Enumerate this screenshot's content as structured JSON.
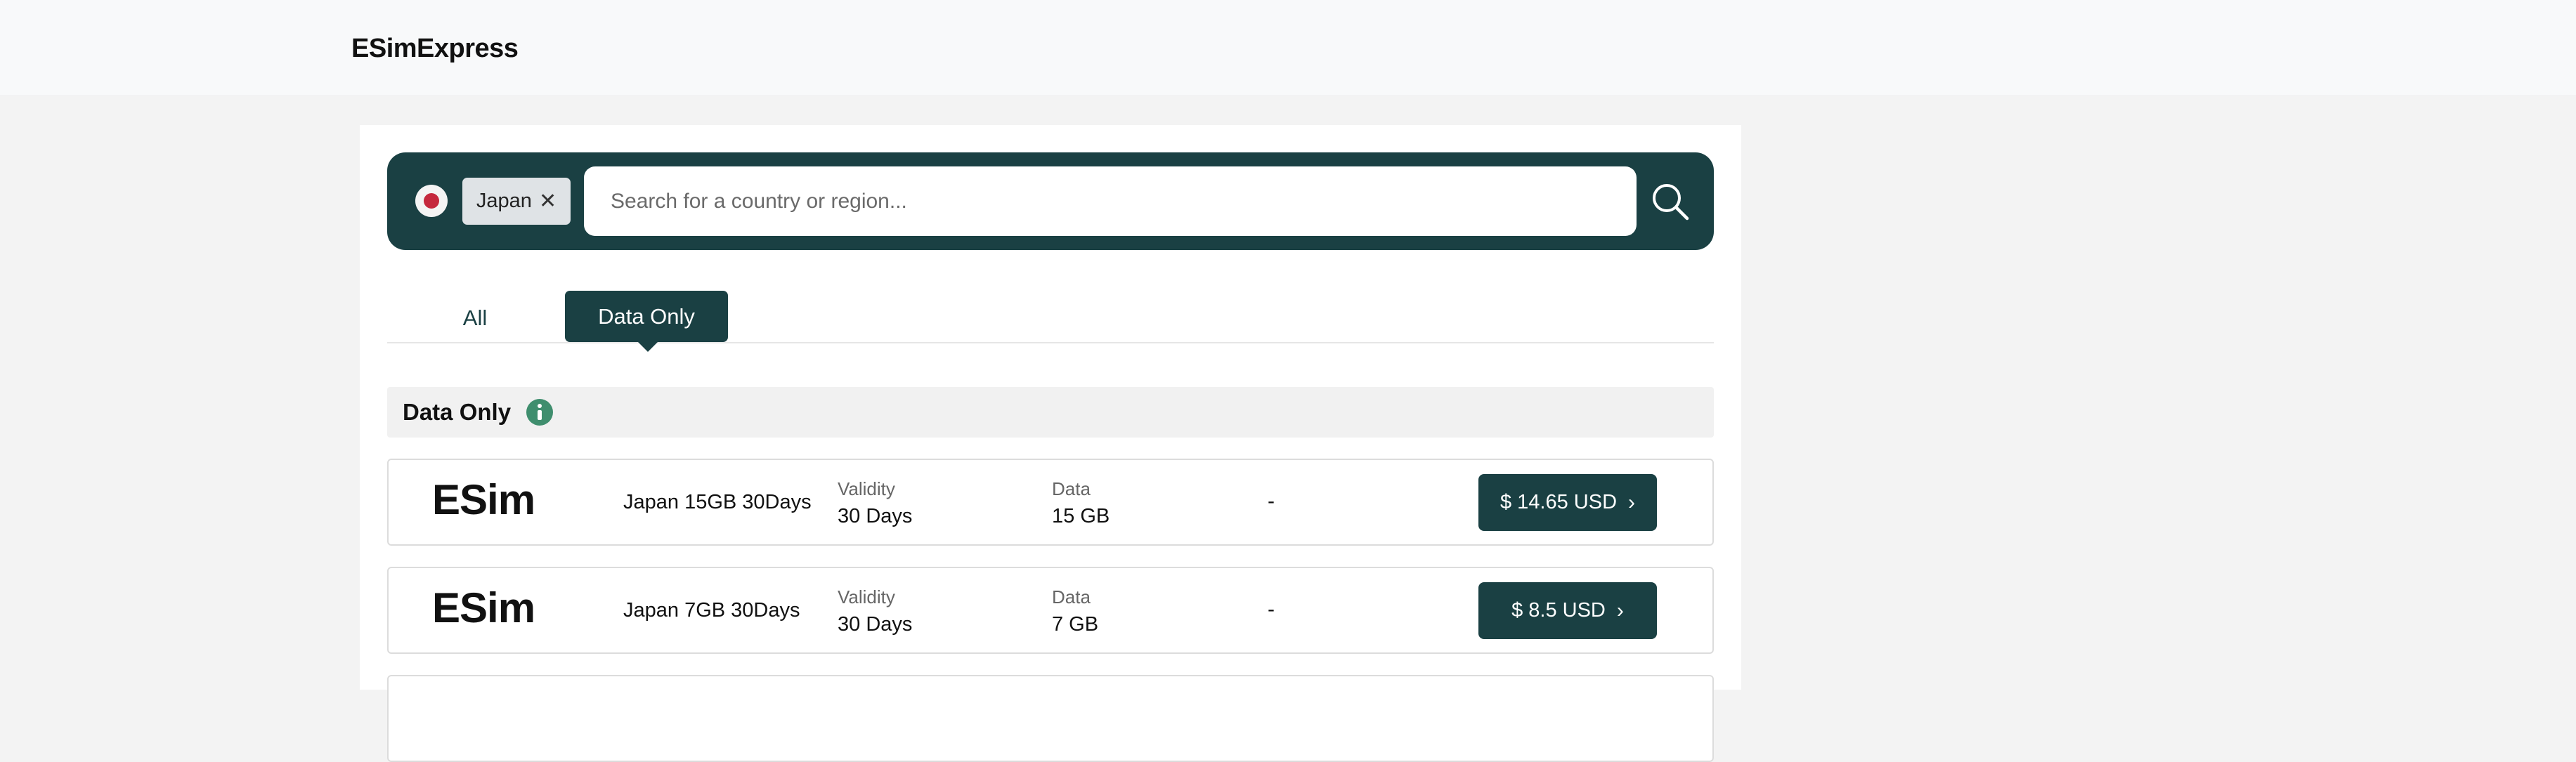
{
  "header": {
    "brand": "ESimExpress"
  },
  "search": {
    "selected_country": "Japan",
    "remove_icon": "✕",
    "placeholder": "Search for a country or region...",
    "flag_color": "#c5283d"
  },
  "tabs": [
    {
      "label": "All",
      "active": false
    },
    {
      "label": "Data Only",
      "active": true
    }
  ],
  "section": {
    "title": "Data Only",
    "icon": "info-icon"
  },
  "plans": [
    {
      "logo": "ESim",
      "name": "Japan 15GB 30Days",
      "validity_label": "Validity",
      "validity": "30 Days",
      "data_label": "Data",
      "data": "15 GB",
      "extra": "-",
      "price": "$ 14.65 USD",
      "chevron": "›"
    },
    {
      "logo": "ESim",
      "name": "Japan 7GB 30Days",
      "validity_label": "Validity",
      "validity": "30 Days",
      "data_label": "Data",
      "data": "7 GB",
      "extra": "-",
      "price": "$ 8.5 USD",
      "chevron": "›"
    }
  ],
  "colors": {
    "accent": "#1a4043",
    "info": "#3f8e6e",
    "background": "#f3f3f3"
  }
}
